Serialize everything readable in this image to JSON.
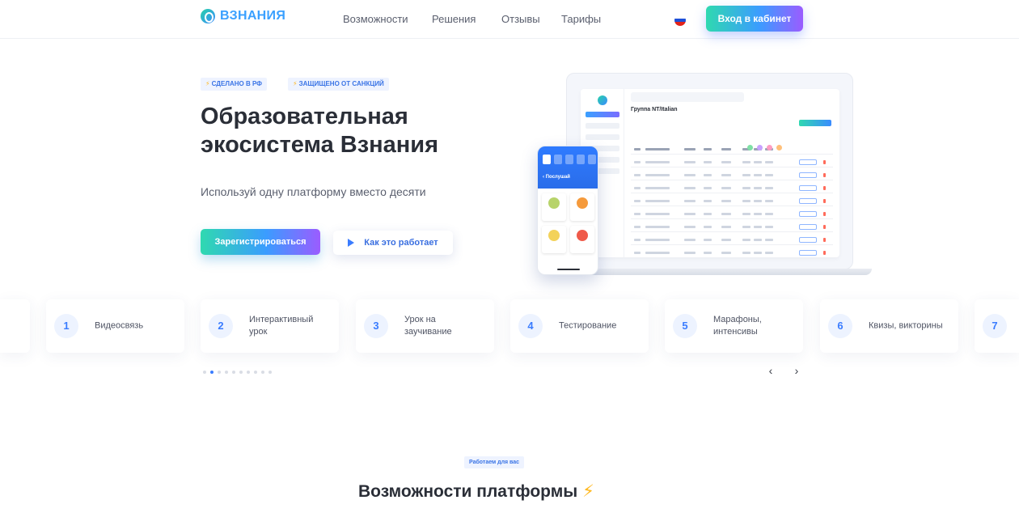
{
  "header": {
    "logo_text": "ВЗНАНИЯ",
    "nav": [
      "Возможности",
      "Решения",
      "Отзывы",
      "Тарифы"
    ],
    "login_label": "Вход в кабинет"
  },
  "hero": {
    "badges": [
      "СДЕЛАНО В РФ",
      "ЗАЩИЩЕНО ОТ САНКЦИЙ"
    ],
    "title": "Образовательная экосистема Взнания",
    "subtitle": "Используй одну платформу вместо десяти",
    "register_label": "Зарегистрироваться",
    "how_label": "Как это работает"
  },
  "mockup": {
    "group_title": "Группа NT/Italian",
    "phone_label": "‹ Послушай"
  },
  "features": [
    {
      "num": "1",
      "label": "Видеосвязь"
    },
    {
      "num": "2",
      "label": "Интерактивный урок"
    },
    {
      "num": "3",
      "label": "Урок на заучивание"
    },
    {
      "num": "4",
      "label": "Тестирование"
    },
    {
      "num": "5",
      "label": "Марафоны, интенсивы"
    },
    {
      "num": "6",
      "label": "Квизы, викторины"
    },
    {
      "num": "7",
      "label": ""
    }
  ],
  "carousel": {
    "pages": 10,
    "active": 1,
    "prev": "‹",
    "next": "›"
  },
  "section": {
    "tag": "Работаем для вас",
    "title": "Возможности платформы"
  },
  "colors": {
    "accent": "#3a7cff",
    "gradient_start": "#2fd9b0",
    "gradient_end": "#9b5cff",
    "bolt": "#ffb81f"
  }
}
